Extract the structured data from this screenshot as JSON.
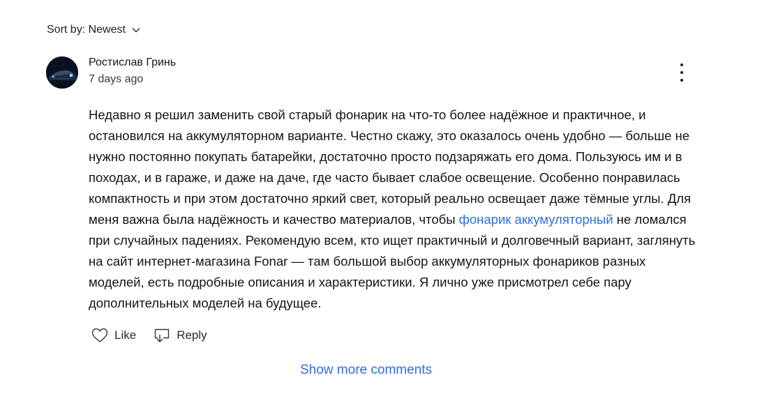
{
  "sort": {
    "label": "Sort by: Newest",
    "icon": "chevron-down-icon"
  },
  "comment": {
    "author": "Ростислав Гринь",
    "timestamp": "7 days ago",
    "avatar_icon": "user-avatar",
    "menu_icon": "more-vertical-icon",
    "body_part1": "Недавно я решил заменить свой старый фонарик на что-то более надёжное и практичное, и остановился на аккумуляторном варианте. Честно скажу, это оказалось очень удобно — больше не нужно постоянно покупать батарейки, достаточно просто подзаряжать его дома. Пользуюсь им и в походах, и в гараже, и даже на даче, где часто бывает слабое освещение. Особенно понравилась компактность и при этом достаточно яркий свет, который реально освещает даже тёмные углы. Для меня важна была надёжность и качество материалов, чтобы ",
    "link_text": "фонарик аккумуляторный",
    "body_part2": " не ломался при случайных падениях. Рекомендую всем, кто ищет практичный и долговечный вариант, заглянуть на сайт интернет-магазина ",
    "brand": "Fonar",
    "body_part3": " — там большой выбор аккумуляторных фонариков разных моделей, есть подробные описания и характеристики. Я лично уже присмотрел себе пару дополнительных моделей на будущее."
  },
  "actions": {
    "like_label": "Like",
    "like_icon": "heart-icon",
    "reply_label": "Reply",
    "reply_icon": "reply-icon"
  },
  "footer": {
    "show_more_label": "Show more comments"
  },
  "colors": {
    "link": "#2f6fd6",
    "text": "#151515"
  }
}
